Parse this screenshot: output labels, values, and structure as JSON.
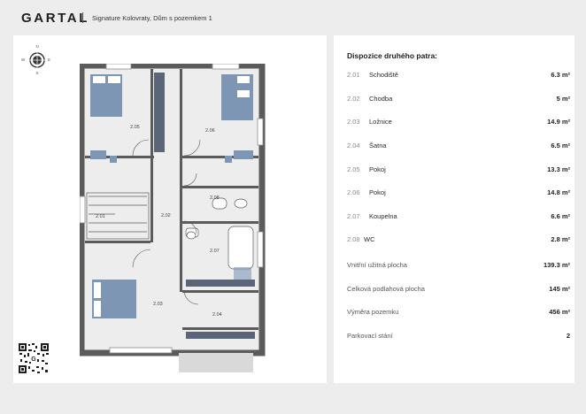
{
  "header": {
    "logo": "GARTAL",
    "subtitle": "Signature Kolovraty, Dům s pozemkem 1"
  },
  "compass": {
    "n": "N",
    "s": "S",
    "e": "E",
    "w": "W"
  },
  "plan_labels": {
    "r2_01": "2.01",
    "r2_02": "2.02",
    "r2_03": "2.03",
    "r2_04": "2.04",
    "r2_05": "2.05",
    "r2_06": "2.06",
    "r2_07": "2.07",
    "r2_08": "2.08"
  },
  "table": {
    "title": "Dispozice druhého patra:",
    "rooms": [
      {
        "num": "2.01",
        "name": "Schodiště",
        "area": "6.3 m²"
      },
      {
        "num": "2.02",
        "name": "Chodba",
        "area": "5 m²"
      },
      {
        "num": "2.03",
        "name": "Ložnice",
        "area": "14.9 m²"
      },
      {
        "num": "2.04",
        "name": "Šatna",
        "area": "6.5 m²"
      },
      {
        "num": "2.05",
        "name": "Pokoj",
        "area": "13.3 m²"
      },
      {
        "num": "2.06",
        "name": "Pokoj",
        "area": "14.8 m²"
      },
      {
        "num": "2.07",
        "name": "Koupelna",
        "area": "6.6 m²"
      },
      {
        "num": "2.08",
        "name": "WC",
        "area": "2.8 m²"
      }
    ],
    "summary": [
      {
        "label": "Vnitřní užitná plocha",
        "value": "139.3 m²"
      },
      {
        "label": "Celková podlahová plocha",
        "value": "145 m²"
      },
      {
        "label": "Výměra pozemku",
        "value": "456 m²"
      },
      {
        "label": "Parkovací stání",
        "value": "2"
      }
    ]
  },
  "colors": {
    "wall": "#5b5b5b",
    "floor": "#ececec",
    "furniture_blue": "#7d96b4",
    "panel": "#ffffff",
    "background": "#ededed"
  }
}
